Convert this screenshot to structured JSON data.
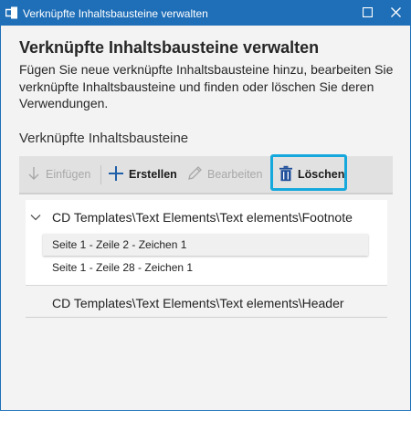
{
  "window": {
    "title": "Verknüpfte Inhaltsbausteine verwalten",
    "icons": {
      "app": "linked-blocks-icon",
      "maximize": "maximize-icon",
      "close": "close-icon"
    },
    "accent": "#1f6fb8"
  },
  "header": {
    "title": "Verknüpfte Inhaltsbausteine verwalten",
    "description": "Fügen Sie neue verknüpfte Inhaltsbausteine hinzu, bearbeiten Sie verknüpfte Inhaltsbausteine und finden oder löschen Sie deren Verwendungen."
  },
  "section": {
    "label": "Verknüpfte Inhaltsbausteine"
  },
  "toolbar": {
    "insert_label": "Einfügen",
    "create_label": "Erstellen",
    "edit_label": "Bearbeiten",
    "delete_label": "Löschen",
    "highlight_color": "#15a8dc"
  },
  "tree": {
    "groups": [
      {
        "label": "CD Templates\\Text Elements\\Text elements\\Footnote",
        "expanded": true,
        "items": [
          {
            "label": "Seite 1 - Zeile 2 - Zeichen 1",
            "selected": true
          },
          {
            "label": "Seite 1 - Zeile 28 - Zeichen 1",
            "selected": false
          }
        ]
      },
      {
        "label": "CD Templates\\Text Elements\\Text elements\\Header",
        "expanded": false,
        "items": []
      }
    ]
  }
}
